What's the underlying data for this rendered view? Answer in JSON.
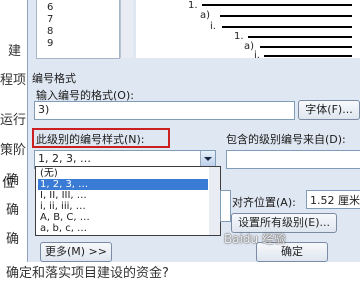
{
  "document": {
    "chars": [
      "建",
      "程项",
      "运行",
      "策阶",
      "确",
      "确",
      "确",
      "确"
    ],
    "bottom_line": "确定和落实项目建设的资金?"
  },
  "preview": {
    "numbers": [
      "6",
      "7",
      "8",
      "9"
    ],
    "tree_labels": [
      "1.",
      "a)",
      "i.",
      "1.",
      "a)",
      "i."
    ]
  },
  "number_format": {
    "section_title": "编号格式",
    "input_label": "输入编号的格式(O):",
    "input_value": "3)",
    "font_button": "字体(F)...",
    "style_label": "此级别的编号样式(N):",
    "include_label": "包含的级别编号来自(D):",
    "style_selected": "1, 2, 3, …",
    "style_options": [
      "(无)",
      "1, 2, 3, …",
      "I, II, III, …",
      "i, ii, iii, …",
      "A, B, C, …",
      "a, b, c, …"
    ]
  },
  "position": {
    "side_char": "位",
    "align_label": "对齐位置(A):",
    "align_value": "1.52 厘米",
    "set_all_button": "设置所有级别(E)..."
  },
  "footer": {
    "more_button": "更多(M) >>",
    "ok_button": "确定",
    "watermark": "Baidu 经验"
  },
  "colors": {
    "highlight_border": "#cc1f1f",
    "selection": "#3a7bd5"
  }
}
